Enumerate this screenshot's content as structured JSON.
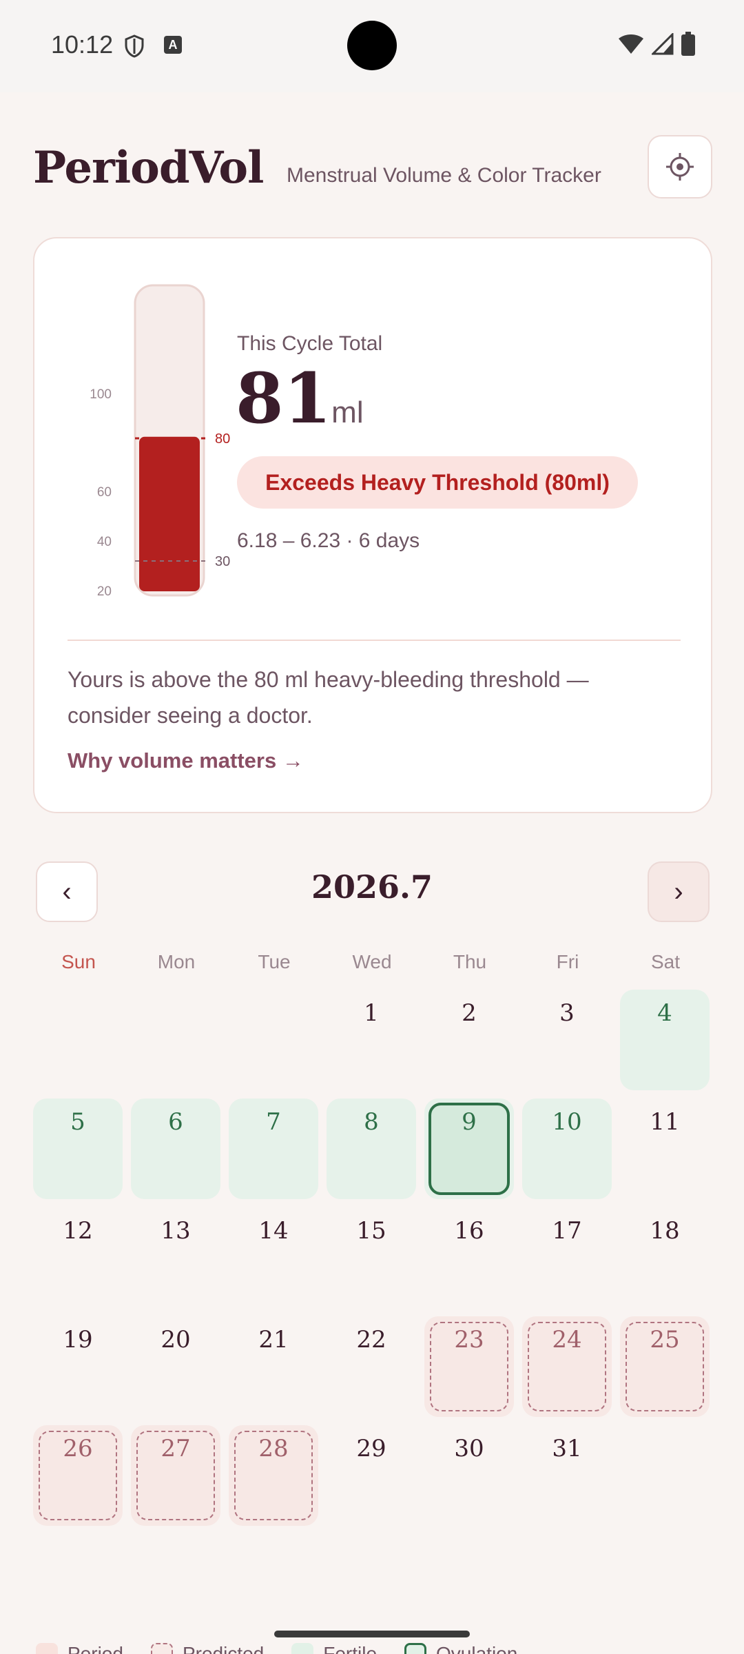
{
  "status": {
    "time": "10:12"
  },
  "header": {
    "title": "PeriodVol",
    "subtitle": "Menstrual Volume & Color Tracker"
  },
  "summary": {
    "label": "This Cycle Total",
    "value": "81",
    "unit": "ml",
    "alert": "Exceeds Heavy Threshold (80ml)",
    "date_range": "6.18 – 6.23 · 6 days",
    "advice": "Yours is above the 80 ml heavy-bleeding threshold — consider seeing a doctor.",
    "link": "Why volume matters →"
  },
  "gauge": {
    "ticks": [
      "100",
      "60",
      "40",
      "20"
    ],
    "max": 100,
    "fill_value": 81,
    "marker_heavy": "80",
    "marker_light": "30"
  },
  "calendar": {
    "month": "2026.7",
    "prev": "‹",
    "next": "›",
    "weekdays": [
      "Sun",
      "Mon",
      "Tue",
      "Wed",
      "Thu",
      "Fri",
      "Sat"
    ],
    "days": [
      {
        "d": "1",
        "t": ""
      },
      {
        "d": "2",
        "t": ""
      },
      {
        "d": "3",
        "t": ""
      },
      {
        "d": "4",
        "t": "fertile"
      },
      {
        "d": "5",
        "t": "fertile"
      },
      {
        "d": "6",
        "t": "fertile"
      },
      {
        "d": "7",
        "t": "fertile"
      },
      {
        "d": "8",
        "t": "fertile"
      },
      {
        "d": "9",
        "t": "ovulation"
      },
      {
        "d": "10",
        "t": "fertile"
      },
      {
        "d": "11",
        "t": ""
      },
      {
        "d": "12",
        "t": ""
      },
      {
        "d": "13",
        "t": ""
      },
      {
        "d": "14",
        "t": ""
      },
      {
        "d": "15",
        "t": ""
      },
      {
        "d": "16",
        "t": ""
      },
      {
        "d": "17",
        "t": ""
      },
      {
        "d": "18",
        "t": ""
      },
      {
        "d": "19",
        "t": ""
      },
      {
        "d": "20",
        "t": ""
      },
      {
        "d": "21",
        "t": ""
      },
      {
        "d": "22",
        "t": ""
      },
      {
        "d": "23",
        "t": "predicted"
      },
      {
        "d": "24",
        "t": "predicted"
      },
      {
        "d": "25",
        "t": "predicted"
      },
      {
        "d": "26",
        "t": "predicted"
      },
      {
        "d": "27",
        "t": "predicted"
      },
      {
        "d": "28",
        "t": "predicted"
      },
      {
        "d": "29",
        "t": ""
      },
      {
        "d": "30",
        "t": ""
      },
      {
        "d": "31",
        "t": ""
      }
    ]
  },
  "legend": {
    "period": "Period",
    "predicted": "Predicted",
    "fertile": "Fertile",
    "ovulation": "Ovulation"
  },
  "colors": {
    "accent": "#b3201f",
    "fertile": "#2e7048",
    "period_bg": "#fbe3e0"
  }
}
